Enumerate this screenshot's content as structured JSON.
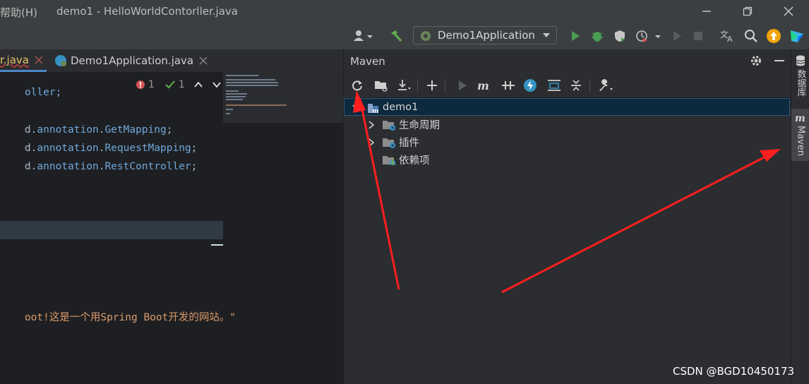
{
  "titlebar": {
    "menu_help": "帮助(H)",
    "window_title": "demo1 - HelloWorldContorller.java"
  },
  "toolbar": {
    "run_config": "Demo1Application"
  },
  "editor": {
    "tabs": [
      {
        "label": "r.java"
      },
      {
        "label": "Demo1Application.java"
      }
    ],
    "inspection": {
      "errors": "1",
      "warnings": "1"
    },
    "lines": [
      {
        "plain": "oller;"
      },
      {
        "pre": "d.",
        "kw": "annotation",
        "mid": ".",
        "kw2": "GetMapping",
        "post": ";"
      },
      {
        "pre": "d.",
        "kw": "annotation",
        "mid": ".",
        "kw2": "RequestMapping",
        "post": ";"
      },
      {
        "pre": "d.",
        "kw": "annotation",
        "mid": ".",
        "kw2": "RestController",
        "post": ";"
      },
      {
        "str": "oot!这是一个用Spring Boot开发的网站。\""
      }
    ]
  },
  "maven": {
    "title": "Maven",
    "tree": [
      {
        "label": "demo1",
        "level": 0,
        "selected": true
      },
      {
        "label": "生命周期",
        "level": 1
      },
      {
        "label": "插件",
        "level": 1
      },
      {
        "label": "依赖项",
        "level": 1
      }
    ]
  },
  "rightbar": {
    "database_label": "数据库",
    "maven_label": "Maven"
  },
  "watermark": "CSDN @BGD10450173",
  "colors": {
    "accent": "#4a88c7",
    "run_green": "#499c54",
    "annotation_red": "#ff1f1f",
    "selection": "#0d293e"
  }
}
